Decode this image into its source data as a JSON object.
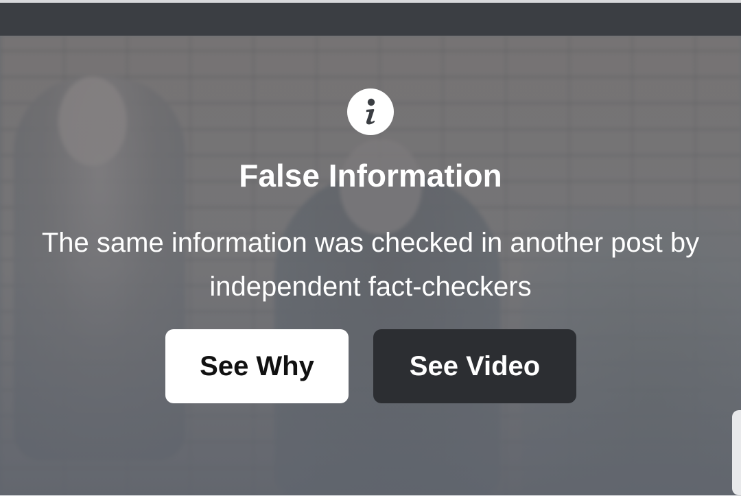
{
  "overlay": {
    "icon": "info-icon",
    "title": "False Information",
    "message": "The same information was checked in another post by independent fact-checkers"
  },
  "buttons": {
    "see_why_label": "See Why",
    "see_video_label": "See Video"
  },
  "colors": {
    "top_bar": "#3b3e43",
    "see_why_bg": "#ffffff",
    "see_video_bg": "#2c2e32",
    "overlay_text": "#ffffff"
  }
}
